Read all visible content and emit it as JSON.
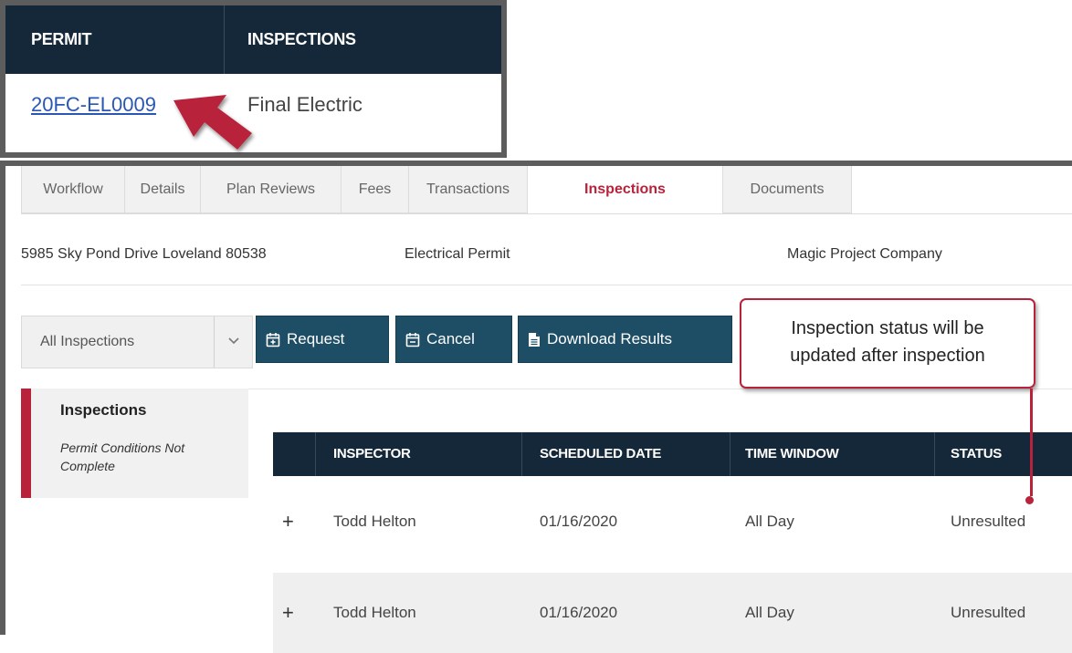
{
  "permit_table": {
    "headers": [
      "PERMIT",
      "INSPECTIONS"
    ],
    "row": {
      "permit": "20FC-EL0009",
      "inspection": "Final Electric"
    }
  },
  "tabs": [
    {
      "label": "Workflow",
      "active": false
    },
    {
      "label": "Details",
      "active": false
    },
    {
      "label": "Plan Reviews",
      "active": false
    },
    {
      "label": "Fees",
      "active": false
    },
    {
      "label": "Transactions",
      "active": false
    },
    {
      "label": "Inspections",
      "active": true
    },
    {
      "label": "Documents",
      "active": false
    }
  ],
  "info": {
    "address": "5985 Sky Pond Drive Loveland 80538",
    "permit_type": "Electrical Permit",
    "company": "Magic Project Company"
  },
  "filter": {
    "selected": "All Inspections"
  },
  "buttons": {
    "request": "Request",
    "cancel": "Cancel",
    "download": "Download Results"
  },
  "callout": {
    "line1": "Inspection status will be",
    "line2": "updated after inspection"
  },
  "sidebar": {
    "title": "Inspections",
    "subtitle": "Permit Conditions Not Complete"
  },
  "inspections_table": {
    "headers": [
      "INSPECTOR",
      "SCHEDULED DATE",
      "TIME WINDOW",
      "STATUS"
    ],
    "expand_symbol": "+",
    "rows": [
      {
        "inspector": "Todd Helton",
        "date": "01/16/2020",
        "window": "All Day",
        "status": "Unresulted"
      },
      {
        "inspector": "Todd Helton",
        "date": "01/16/2020",
        "window": "All Day",
        "status": "Unresulted"
      }
    ]
  },
  "colors": {
    "header_bg": "#14283a",
    "button_bg": "#1e4e66",
    "accent_red": "#b8233b",
    "link_blue": "#2a57b3"
  }
}
